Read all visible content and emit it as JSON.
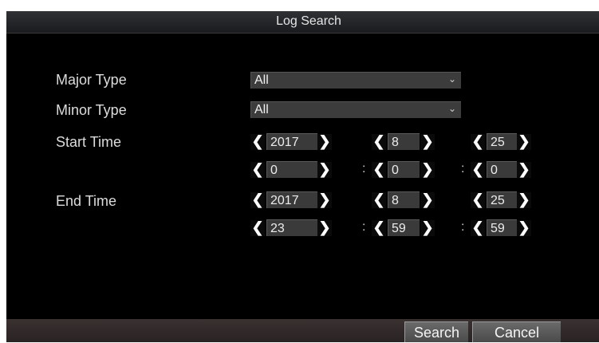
{
  "dialog": {
    "title": "Log Search",
    "fields": {
      "major_type_label": "Major Type",
      "minor_type_label": "Minor Type",
      "start_time_label": "Start Time",
      "end_time_label": "End Time"
    },
    "major_type_value": "All",
    "minor_type_value": "All",
    "start_time": {
      "year": "2017",
      "month": "8",
      "day": "25",
      "hour": "0",
      "minute": "0",
      "second": "0"
    },
    "end_time": {
      "year": "2017",
      "month": "8",
      "day": "25",
      "hour": "23",
      "minute": "59",
      "second": "59"
    },
    "colon": ":",
    "arrows": {
      "left": "❮",
      "right": "❯",
      "dropdown": "⌄"
    },
    "buttons": {
      "search": "Search",
      "cancel": "Cancel"
    }
  }
}
